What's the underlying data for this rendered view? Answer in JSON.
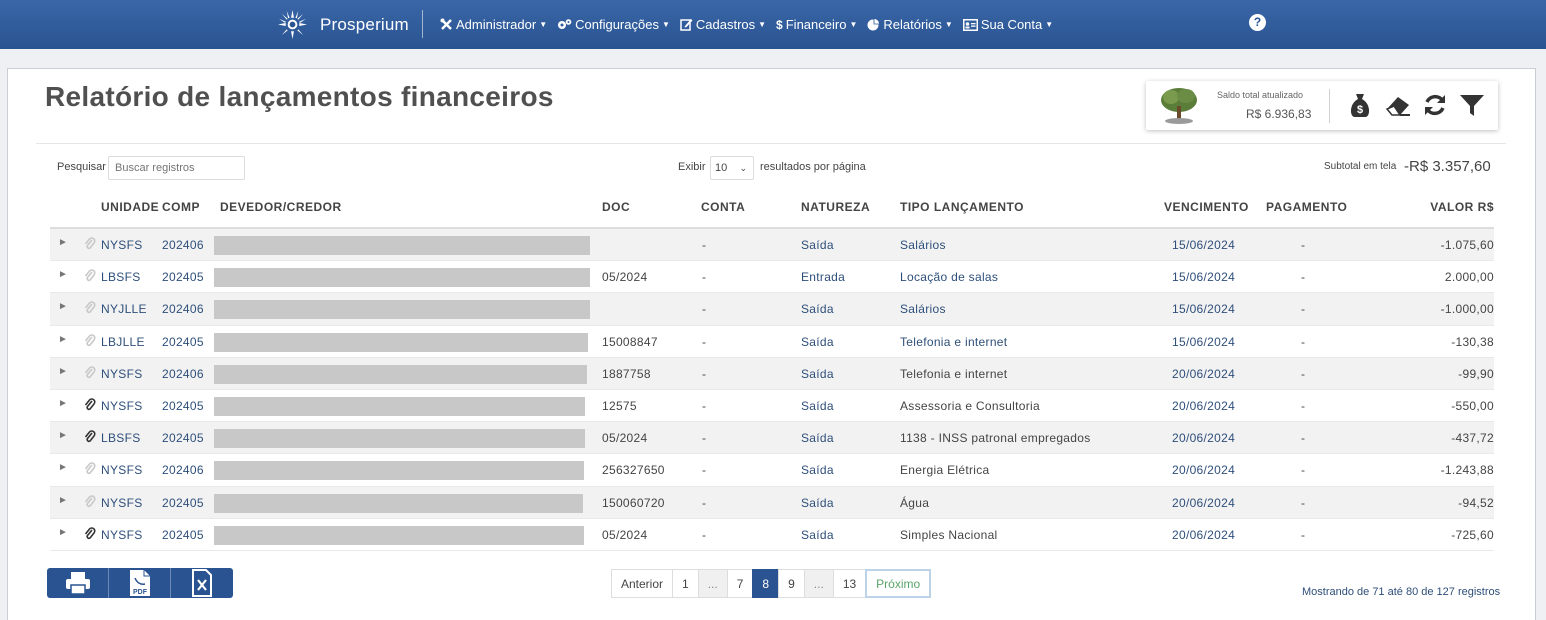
{
  "app": {
    "name": "Prosperium",
    "help_label": "?"
  },
  "menu": [
    {
      "label": "Administrador",
      "icon": "wrench-cross-icon"
    },
    {
      "label": "Configurações",
      "icon": "cogs-icon"
    },
    {
      "label": "Cadastros",
      "icon": "edit-icon"
    },
    {
      "label": "Financeiro",
      "icon": "dollar-icon"
    },
    {
      "label": "Relatórios",
      "icon": "pie-chart-icon"
    },
    {
      "label": "Sua Conta",
      "icon": "id-card-icon"
    }
  ],
  "page": {
    "title": "Relatório de lançamentos financeiros"
  },
  "balance": {
    "label": "Saldo total atualizado",
    "value": "R$ 6.936,83"
  },
  "controls": {
    "search_label": "Pesquisar",
    "search_placeholder": "Buscar registros",
    "exibir_label": "Exibir",
    "per_page_value": "10",
    "per_page_suffix": "resultados por página",
    "subtotal_label": "Subtotal em tela",
    "subtotal_value": "-R$ 3.357,60"
  },
  "table": {
    "headers": {
      "unidade": "UNIDADE",
      "comp": "COMP",
      "devedor": "DEVEDOR/CREDOR",
      "doc": "DOC",
      "conta": "CONTA",
      "natureza": "NATUREZA",
      "tipo": "TIPO LANÇAMENTO",
      "vencimento": "VENCIMENTO",
      "pagamento": "PAGAMENTO",
      "valor": "VALOR R$"
    },
    "rows": [
      {
        "unidade": "NYSFS",
        "comp": "202406",
        "doc": "",
        "conta": "-",
        "natureza": "Saída",
        "tipo": "Salários",
        "vencimento": "15/06/2024",
        "pagamento": "-",
        "valor": "-1.075,60",
        "attachment": false
      },
      {
        "unidade": "LBSFS",
        "comp": "202405",
        "doc": "05/2024",
        "conta": "-",
        "natureza": "Entrada",
        "tipo": "Locação de salas",
        "vencimento": "15/06/2024",
        "pagamento": "-",
        "valor": "2.000,00",
        "attachment": false
      },
      {
        "unidade": "NYJLLE",
        "comp": "202406",
        "doc": "",
        "conta": "-",
        "natureza": "Saída",
        "tipo": "Salários",
        "vencimento": "15/06/2024",
        "pagamento": "-",
        "valor": "-1.000,00",
        "attachment": false
      },
      {
        "unidade": "LBJLLE",
        "comp": "202405",
        "doc": "15008847",
        "conta": "-",
        "natureza": "Saída",
        "tipo": "Telefonia e internet",
        "vencimento": "15/06/2024",
        "pagamento": "-",
        "valor": "-130,38",
        "attachment": false
      },
      {
        "unidade": "NYSFS",
        "comp": "202406",
        "doc": "1887758",
        "conta": "-",
        "natureza": "Saída",
        "tipo": "Telefonia e internet",
        "vencimento": "20/06/2024",
        "pagamento": "-",
        "valor": "-99,90",
        "attachment": false
      },
      {
        "unidade": "NYSFS",
        "comp": "202405",
        "doc": "12575",
        "conta": "-",
        "natureza": "Saída",
        "tipo": "Assessoria e Consultoria",
        "vencimento": "20/06/2024",
        "pagamento": "-",
        "valor": "-550,00",
        "attachment": true
      },
      {
        "unidade": "LBSFS",
        "comp": "202405",
        "doc": "05/2024",
        "conta": "-",
        "natureza": "Saída",
        "tipo": "1138 - INSS patronal empregados",
        "vencimento": "20/06/2024",
        "pagamento": "-",
        "valor": "-437,72",
        "attachment": true
      },
      {
        "unidade": "NYSFS",
        "comp": "202406",
        "doc": "256327650",
        "conta": "-",
        "natureza": "Saída",
        "tipo": "Energia Elétrica",
        "vencimento": "20/06/2024",
        "pagamento": "-",
        "valor": "-1.243,88",
        "attachment": false
      },
      {
        "unidade": "NYSFS",
        "comp": "202405",
        "doc": "150060720",
        "conta": "-",
        "natureza": "Saída",
        "tipo": "Água",
        "vencimento": "20/06/2024",
        "pagamento": "-",
        "valor": "-94,52",
        "attachment": false
      },
      {
        "unidade": "NYSFS",
        "comp": "202405",
        "doc": "05/2024",
        "conta": "-",
        "natureza": "Saída",
        "tipo": "Simples Nacional",
        "vencimento": "20/06/2024",
        "pagamento": "-",
        "valor": "-725,60",
        "attachment": true
      }
    ]
  },
  "export": {
    "pdf_label": "PDF"
  },
  "pagination": {
    "prev": "Anterior",
    "pages": [
      "1",
      "...",
      "7",
      "8",
      "9",
      "...",
      "13"
    ],
    "active": "8",
    "next": "Próximo"
  },
  "footer": {
    "showing": "Mostrando de 71 até 80 de 127 registros"
  },
  "colors": {
    "primary": "#2a5491",
    "link": "#2e4f7a",
    "next_green": "#5aa469"
  }
}
